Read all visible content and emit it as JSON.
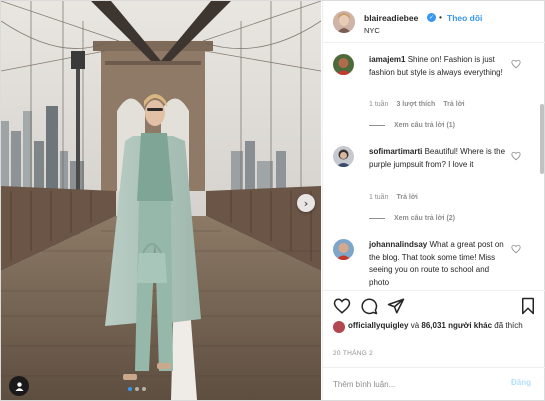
{
  "header": {
    "username": "blaireadiebee",
    "separator": "•",
    "follow_label": "Theo dõi",
    "location": "NYC",
    "verified_icon": "verified-badge-icon"
  },
  "comments": [
    {
      "username": "iamajem1",
      "text": "Shine on! Fashion is just fashion but style is always everything!",
      "time": "1 tuần",
      "likes": "3 lượt thích",
      "reply_label": "Trả lời",
      "view_replies": "Xem câu trả lời (1)"
    },
    {
      "username": "sofimartimarti",
      "text": "Beautiful! Where is the purple jumpsuit from? I love it",
      "time": "1 tuần",
      "reply_label": "Trả lời",
      "view_replies": "Xem câu trả lời (2)"
    },
    {
      "username": "johannalindsay",
      "text": "What a great post on the blog. That took some time! Miss seeing you on route to school and photo"
    }
  ],
  "likes": {
    "user": "officiallyquigley",
    "and": "và",
    "count_text": "86,031 người khác",
    "suffix": "đã thích"
  },
  "date": "20 THÁNG 2",
  "add_comment": {
    "placeholder": "Thêm bình luận...",
    "post_label": "Đăng"
  },
  "colors": {
    "accent": "#3897f0",
    "post_disabled": "#b2dffc",
    "muted": "#8e8e8e",
    "text": "#262626"
  }
}
